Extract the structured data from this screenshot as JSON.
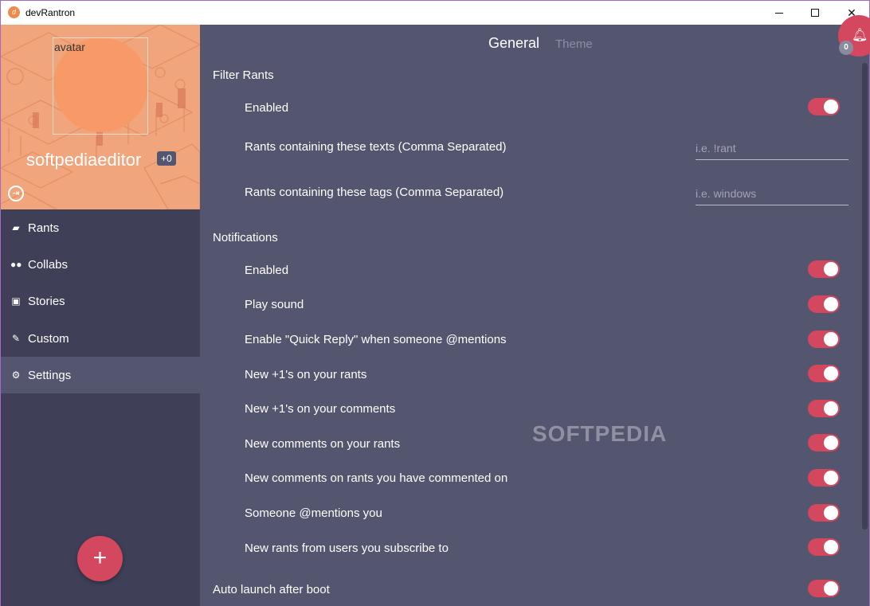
{
  "window": {
    "title": "devRantron",
    "min_icon": "minimize-icon",
    "max_icon": "maximize-icon",
    "close_icon": "close-icon"
  },
  "profile": {
    "avatar_label": "avatar",
    "username": "softpediaeditor",
    "score": "+0"
  },
  "nav": [
    {
      "label": "Rants",
      "icon": "rants-icon",
      "active": false
    },
    {
      "label": "Collabs",
      "icon": "collabs-icon",
      "active": false
    },
    {
      "label": "Stories",
      "icon": "stories-icon",
      "active": false
    },
    {
      "label": "Custom",
      "icon": "custom-icon",
      "active": false
    },
    {
      "label": "Settings",
      "icon": "gear-icon",
      "active": true
    }
  ],
  "tabs": {
    "general": "General",
    "theme": "Theme",
    "active": "General"
  },
  "notifications_badge": {
    "count": "0"
  },
  "settings": {
    "filter_rants": {
      "title": "Filter Rants",
      "enabled_label": "Enabled",
      "enabled": true,
      "texts_label": "Rants containing these texts (Comma Separated)",
      "texts_placeholder": "i.e. !rant",
      "texts_value": "",
      "tags_label": "Rants containing these tags (Comma Separated)",
      "tags_placeholder": "i.e. windows",
      "tags_value": ""
    },
    "notifications": {
      "title": "Notifications",
      "items": [
        {
          "label": "Enabled",
          "on": true
        },
        {
          "label": "Play sound",
          "on": true
        },
        {
          "label": "Enable \"Quick Reply\" when someone @mentions",
          "on": true
        },
        {
          "label": "New +1's on your rants",
          "on": true
        },
        {
          "label": "New +1's on your comments",
          "on": true
        },
        {
          "label": "New comments on your rants",
          "on": true
        },
        {
          "label": "New comments on rants you have commented on",
          "on": true
        },
        {
          "label": "Someone @mentions you",
          "on": true
        },
        {
          "label": "New rants from users you subscribe to",
          "on": true
        }
      ]
    },
    "auto_launch": {
      "title": "Auto launch after boot",
      "on": true
    }
  },
  "watermark": "SOFTPEDIA",
  "colors": {
    "accent": "#d3485f",
    "sidebar": "#3f4058",
    "main": "#54556f",
    "profile_bg": "#f0a57d"
  }
}
